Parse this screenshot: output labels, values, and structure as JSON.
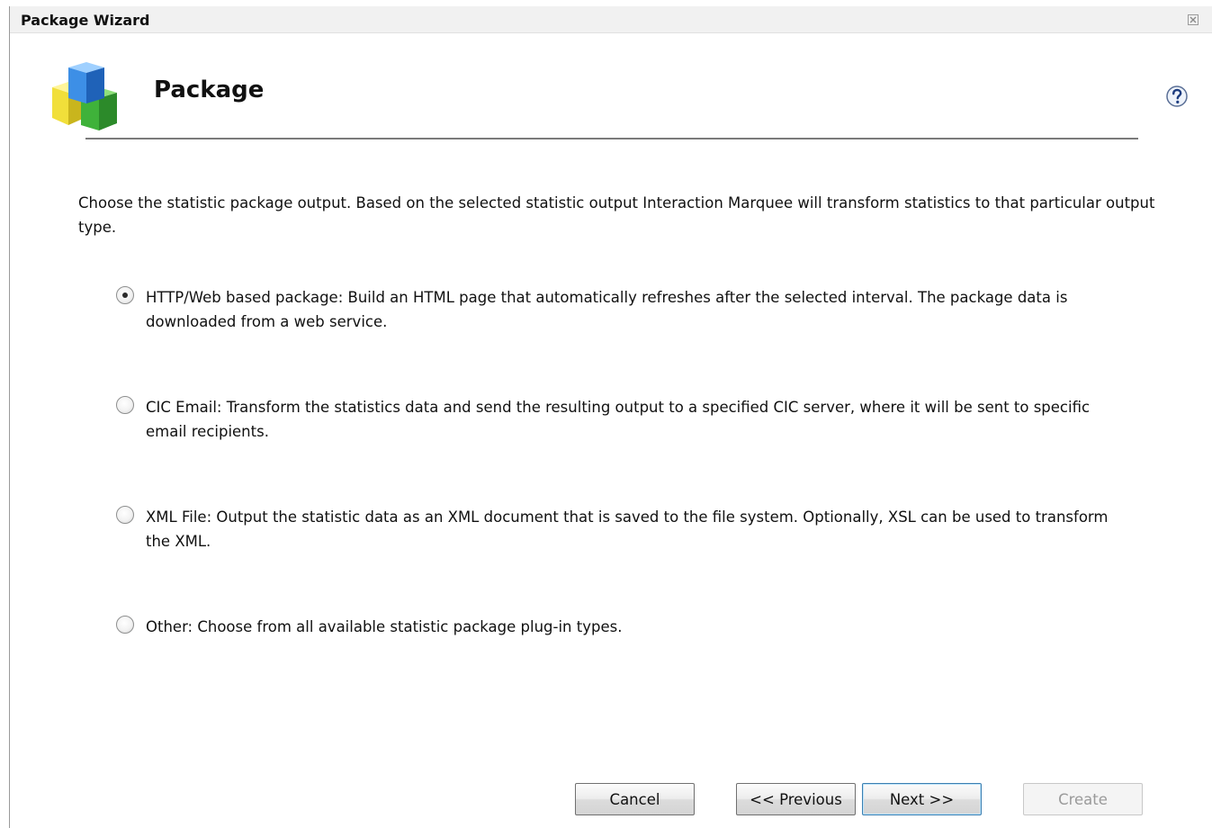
{
  "window": {
    "title": "Package Wizard"
  },
  "header": {
    "title": "Package",
    "logo_icon": "package-cubes-icon",
    "help_icon": "help-icon"
  },
  "intro_text": "Choose the statistic package output.  Based on the selected statistic output Interaction Marquee will transform statistics to that particular output type.",
  "options": [
    {
      "label": "HTTP/Web based package: Build an HTML page that automatically refreshes after the selected interval. The package data is downloaded from a web service.",
      "selected": true
    },
    {
      "label": "CIC Email: Transform the statistics data and send the resulting output to a specified CIC server, where it will be sent to specific email recipients.",
      "selected": false
    },
    {
      "label": "XML File: Output the statistic data as an XML document that is saved to the file system. Optionally, XSL can be used to transform the XML.",
      "selected": false
    },
    {
      "label": "Other: Choose from all available statistic package plug-in types.",
      "selected": false
    }
  ],
  "buttons": {
    "cancel": "Cancel",
    "previous": "<< Previous",
    "next": "Next >>",
    "create": "Create"
  },
  "colors": {
    "default_button_border": "#3c7fb1",
    "disabled_text": "#9a9a9a"
  }
}
